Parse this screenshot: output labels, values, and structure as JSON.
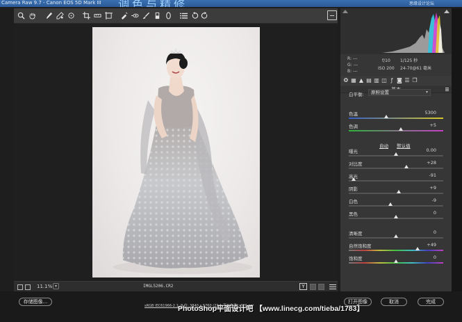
{
  "window": {
    "title": "Camera Raw 9.7 - Canon EOS 5D Mark III",
    "overlay_title": "调色与精修",
    "right_text": "思缘设计论坛"
  },
  "toolbar": {
    "tools": [
      "zoom-icon",
      "hand-icon",
      "white-balance-icon",
      "color-sampler-icon",
      "targeted-adjustment-icon",
      "crop-icon",
      "straighten-icon",
      "transform-icon",
      "spot-removal-icon",
      "red-eye-icon",
      "adjustment-brush-icon",
      "graduated-filter-icon",
      "radial-filter-icon",
      "preferences-icon",
      "rotate-left-icon",
      "rotate-right-icon"
    ]
  },
  "status": {
    "zoom": "11.1%",
    "filename": "IMGL5206.CR2",
    "y_label": "Y"
  },
  "histogram": {
    "rgb": [
      "R: ---",
      "G: ---",
      "B: ---"
    ],
    "aperture": "f/10",
    "shutter": "1/125 秒",
    "iso": "ISO 200",
    "lens": "24-70@61 毫米"
  },
  "panel": {
    "title": "基本",
    "wb_label": "白平衡:",
    "wb_value": "原照设置",
    "auto_label": "自动",
    "default_label": "默认值"
  },
  "controls": [
    {
      "label": "色温",
      "value": "5300",
      "pos": 0.4
    },
    {
      "label": "色调",
      "value": "+5",
      "pos": 0.55
    },
    {
      "label": "曝光",
      "value": "0.00",
      "pos": 0.5
    },
    {
      "label": "对比度",
      "value": "+28",
      "pos": 0.61
    },
    {
      "label": "高光",
      "value": "-91",
      "pos": 0.05
    },
    {
      "label": "阴影",
      "value": "+9",
      "pos": 0.53
    },
    {
      "label": "白色",
      "value": "-9",
      "pos": 0.44
    },
    {
      "label": "黑色",
      "value": "0",
      "pos": 0.5
    },
    {
      "label": "清晰度",
      "value": "0",
      "pos": 0.5
    },
    {
      "label": "自然饱和度",
      "value": "+49",
      "pos": 0.73
    },
    {
      "label": "饱和度",
      "value": "0",
      "pos": 0.5
    }
  ],
  "bottom": {
    "save_label": "存储图像...",
    "workflow_link": "sRGB IEC61966-2.1; 8 位; 3840 x 5760 (22.1 百万像素); 300 ppi",
    "open_label": "打开图像",
    "cancel_label": "取消",
    "done_label": "完成",
    "watermark": "PhotoShop平面设计吧 【www.linecg.com/tieba/1783】"
  },
  "colors": {
    "panel_bg": "#363636",
    "canvas_bg": "#1f1f1f",
    "photo_bg": "#eeebea",
    "temp_left": "#3560c8",
    "temp_right": "#d8c82a",
    "tint_left": "#2fb33a",
    "tint_right": "#c83ec8"
  }
}
